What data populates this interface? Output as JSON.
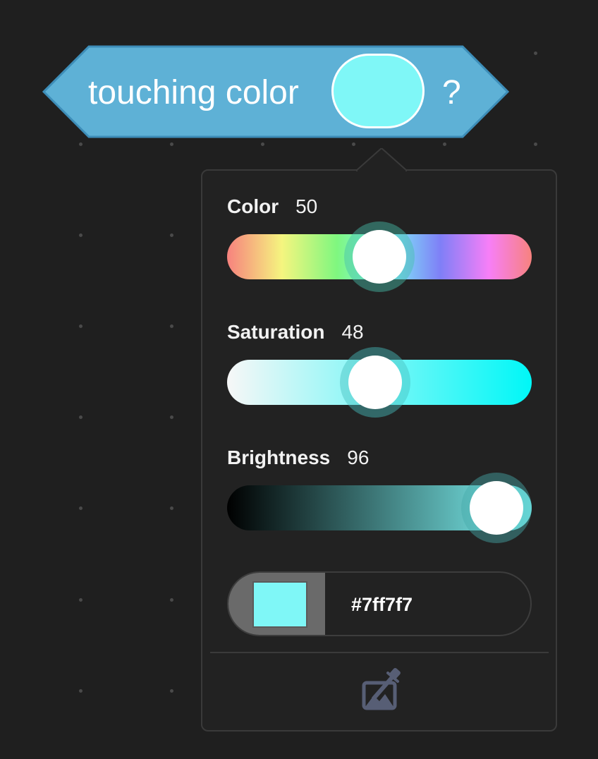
{
  "block": {
    "label": "touching color",
    "suffix": "?",
    "fill": "#5eb1d6",
    "stroke": "#3d8db8",
    "swatch_color": "#7ff7f7"
  },
  "picker": {
    "color": {
      "label": "Color",
      "value": "50"
    },
    "saturation": {
      "label": "Saturation",
      "value": "48"
    },
    "brightness": {
      "label": "Brightness",
      "value": "96"
    },
    "hex": {
      "value": "#7ff7f7",
      "swatch_color": "#7ff7f7"
    },
    "eyedropper_icon": "eyedropper-icon"
  },
  "colors": {
    "background": "#1f1f1f",
    "popup": "#222222",
    "icon": "#575e75"
  }
}
